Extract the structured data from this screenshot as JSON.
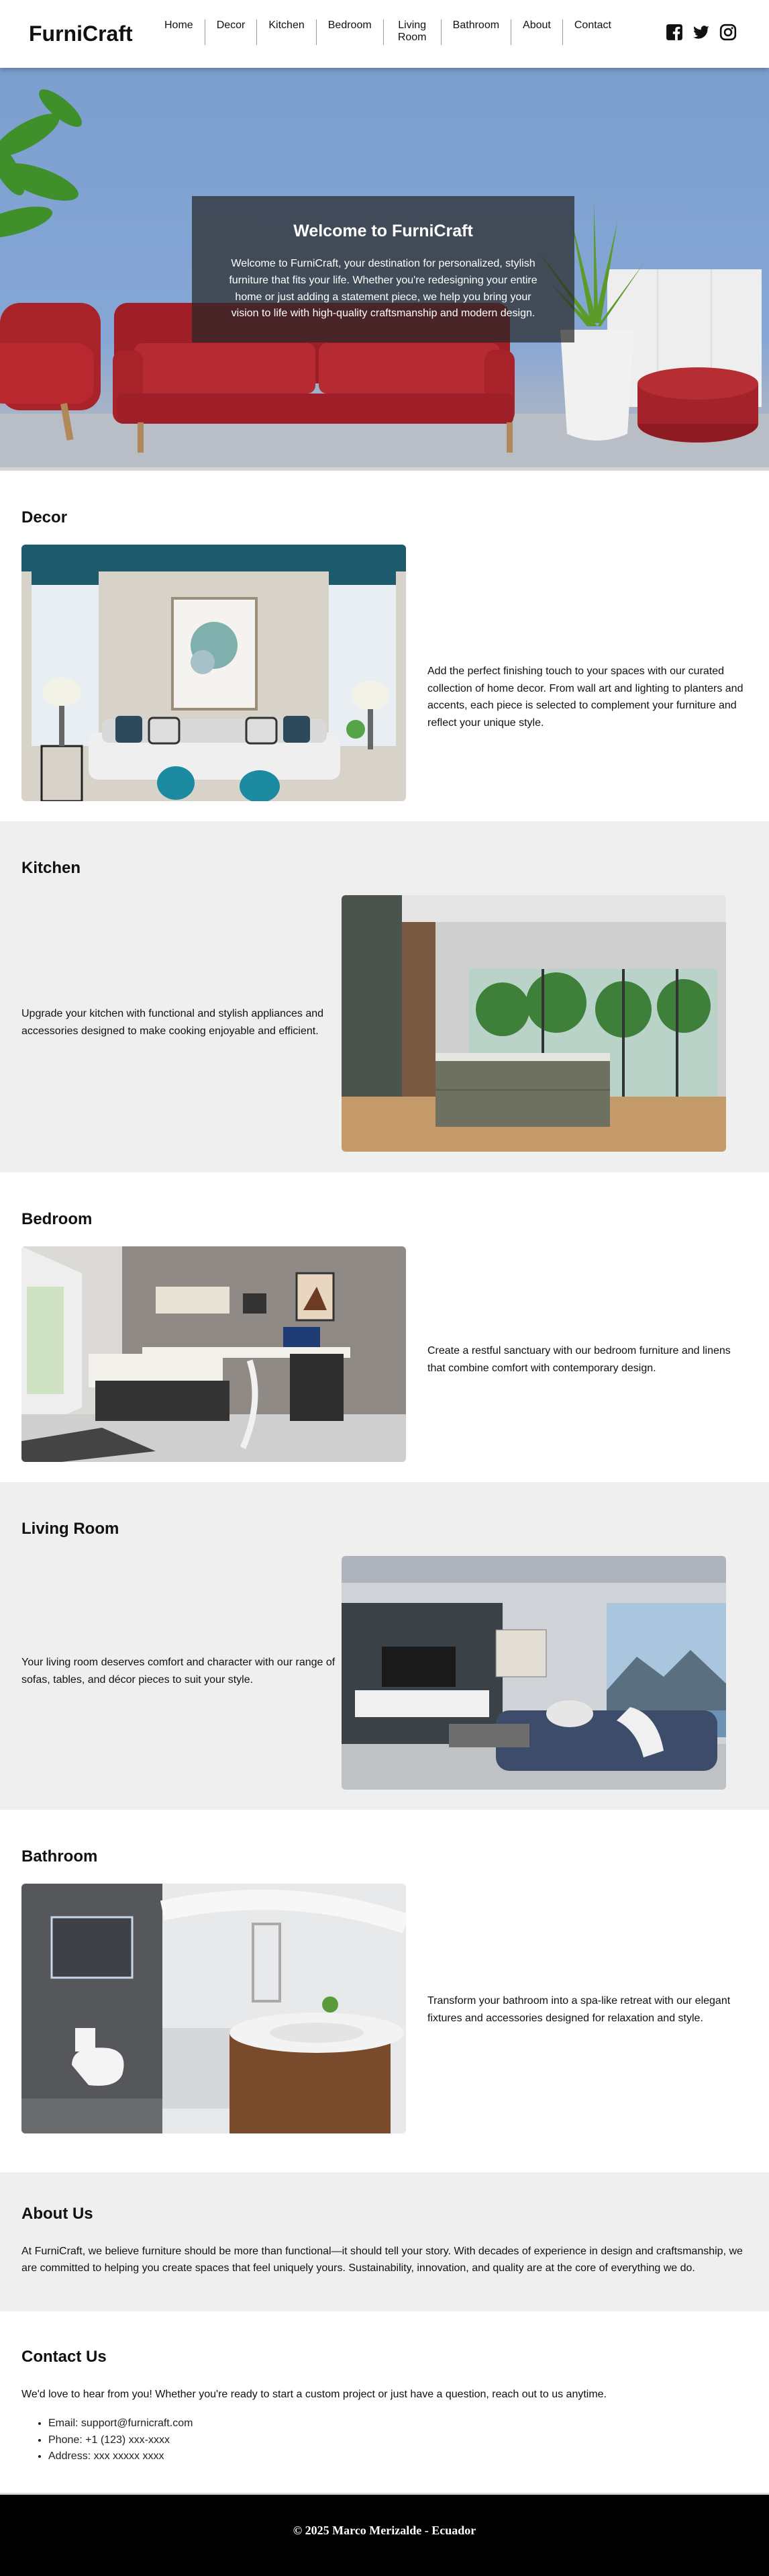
{
  "header": {
    "logo": "FurniCraft",
    "nav": [
      "Home",
      "Decor",
      "Kitchen",
      "Bedroom",
      "Living Room",
      "Bathroom",
      "About",
      "Contact"
    ],
    "social_icons": [
      "facebook-icon",
      "twitter-icon",
      "instagram-icon"
    ]
  },
  "hero": {
    "title": "Welcome to FurniCraft",
    "text": "Welcome to FurniCraft, your destination for personalized, stylish furniture that fits your life. Whether you're redesigning your entire home or just adding a statement piece, we help you bring your vision to life with high-quality craftsmanship and modern design."
  },
  "sections": {
    "decor": {
      "title": "Decor",
      "text": "Add the perfect finishing touch to your spaces with our curated collection of home decor. From wall art and lighting to planters and accents, each piece is selected to complement your furniture and reflect your unique style."
    },
    "kitchen": {
      "title": "Kitchen",
      "text": "Upgrade your kitchen with functional and stylish appliances and accessories designed to make cooking enjoyable and efficient."
    },
    "bedroom": {
      "title": "Bedroom",
      "text": "Create a restful sanctuary with our bedroom furniture and linens that combine comfort with contemporary design."
    },
    "living": {
      "title": "Living Room",
      "text": "Your living room deserves comfort and character with our range of sofas, tables, and décor pieces to suit your style."
    },
    "bathroom": {
      "title": "Bathroom",
      "text": "Transform your bathroom into a spa-like retreat with our elegant fixtures and accessories designed for relaxation and style."
    }
  },
  "about": {
    "title": "About Us",
    "text": "At FurniCraft, we believe furniture should be more than functional—it should tell your story. With decades of experience in design and craftsmanship, we are committed to helping you create spaces that feel uniquely yours. Sustainability, innovation, and quality are at the core of everything we do."
  },
  "contact": {
    "title": "Contact Us",
    "intro": "We'd love to hear from you! Whether you're ready to start a custom project or just have a question, reach out to us anytime.",
    "items": [
      "Email: support@furnicraft.com",
      "Phone: +1 (123) xxx-xxxx",
      "Address: xxx xxxxx xxxx"
    ]
  },
  "footer": {
    "text": "© 2025 Marco Merizalde - Ecuador"
  }
}
